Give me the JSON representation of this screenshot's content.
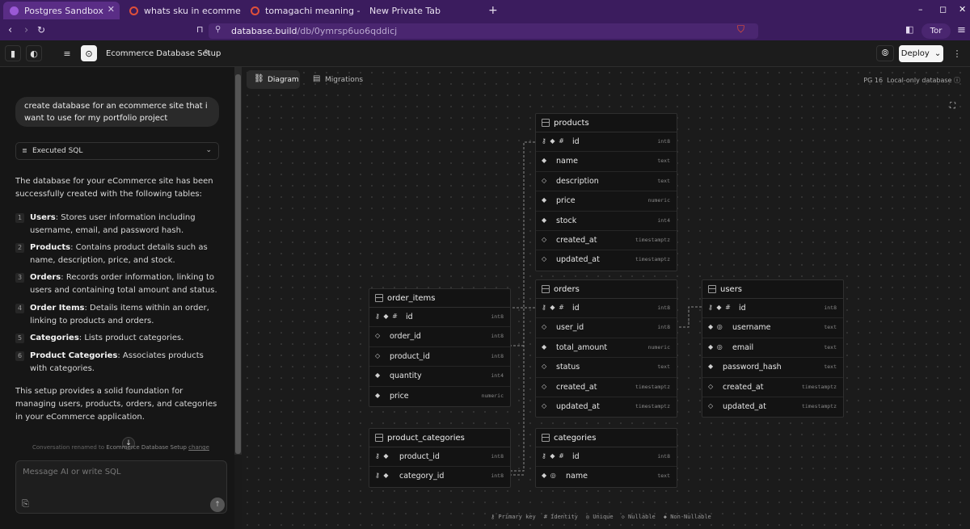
{
  "browser": {
    "tabs": [
      {
        "label": "Postgres Sandbox"
      },
      {
        "label": "whats sku in ecommerce"
      },
      {
        "label": "tomagachi meaning - Brave"
      },
      {
        "label": "New Private Tab"
      }
    ],
    "url_host": "database.build",
    "url_path": "/db/0ymrsp6uo6qddicj",
    "tor_label": "Tor"
  },
  "app": {
    "title": "Ecommerce Database Setup",
    "deploy_label": "Deploy"
  },
  "chat": {
    "user_message": "create database for an ecommerce site that i want to use for my portfolio project",
    "sql_label": "Executed SQL",
    "intro": "The database for your eCommerce site has been successfully created with the following tables:",
    "items": [
      {
        "num": "1",
        "bold": "Users",
        "text": ": Stores user information including username, email, and password hash."
      },
      {
        "num": "2",
        "bold": "Products",
        "text": ": Contains product details such as name, description, price, and stock."
      },
      {
        "num": "3",
        "bold": "Orders",
        "text": ": Records order information, linking to users and containing total amount and status."
      },
      {
        "num": "4",
        "bold": "Order Items",
        "text": ": Details items within an order, linking to products and orders."
      },
      {
        "num": "5",
        "bold": "Categories",
        "text": ": Lists product categories."
      },
      {
        "num": "6",
        "bold": "Product Categories",
        "text": ": Associates products with categories."
      }
    ],
    "outro": "This setup provides a solid foundation for managing users, products, orders, and categories in your eCommerce application.",
    "renamed_prefix": "Conversation renamed to",
    "renamed_name": "Ecommerce Database Setup",
    "renamed_link": "change",
    "input_placeholder": "Message AI or write SQL"
  },
  "canvas": {
    "diagram_tab": "Diagram",
    "migrations_tab": "Migrations",
    "pg_version": "PG 16",
    "local_only": "Local-only database",
    "legend": [
      "Primary key",
      "Identity",
      "Unique",
      "Nullable",
      "Non-Nullable"
    ]
  },
  "tables": {
    "products": {
      "name": "products",
      "columns": [
        {
          "name": "id",
          "type": "int8",
          "icons": "⚷ ◆ #"
        },
        {
          "name": "name",
          "type": "text",
          "icons": "◆"
        },
        {
          "name": "description",
          "type": "text",
          "icons": "◇"
        },
        {
          "name": "price",
          "type": "numeric",
          "icons": "◆"
        },
        {
          "name": "stock",
          "type": "int4",
          "icons": "◆"
        },
        {
          "name": "created_at",
          "type": "timestamptz",
          "icons": "◇"
        },
        {
          "name": "updated_at",
          "type": "timestamptz",
          "icons": "◇"
        }
      ]
    },
    "order_items": {
      "name": "order_items",
      "columns": [
        {
          "name": "id",
          "type": "int8",
          "icons": "⚷ ◆ #"
        },
        {
          "name": "order_id",
          "type": "int8",
          "icons": "◇"
        },
        {
          "name": "product_id",
          "type": "int8",
          "icons": "◇"
        },
        {
          "name": "quantity",
          "type": "int4",
          "icons": "◆"
        },
        {
          "name": "price",
          "type": "numeric",
          "icons": "◆"
        }
      ]
    },
    "orders": {
      "name": "orders",
      "columns": [
        {
          "name": "id",
          "type": "int8",
          "icons": "⚷ ◆ #"
        },
        {
          "name": "user_id",
          "type": "int8",
          "icons": "◇"
        },
        {
          "name": "total_amount",
          "type": "numeric",
          "icons": "◆"
        },
        {
          "name": "status",
          "type": "text",
          "icons": "◇"
        },
        {
          "name": "created_at",
          "type": "timestamptz",
          "icons": "◇"
        },
        {
          "name": "updated_at",
          "type": "timestamptz",
          "icons": "◇"
        }
      ]
    },
    "users": {
      "name": "users",
      "columns": [
        {
          "name": "id",
          "type": "int8",
          "icons": "⚷ ◆ #"
        },
        {
          "name": "username",
          "type": "text",
          "icons": "◆ ◎"
        },
        {
          "name": "email",
          "type": "text",
          "icons": "◆ ◎"
        },
        {
          "name": "password_hash",
          "type": "text",
          "icons": "◆"
        },
        {
          "name": "created_at",
          "type": "timestamptz",
          "icons": "◇"
        },
        {
          "name": "updated_at",
          "type": "timestamptz",
          "icons": "◇"
        }
      ]
    },
    "product_categories": {
      "name": "product_categories",
      "columns": [
        {
          "name": "product_id",
          "type": "int8",
          "icons": "⚷ ◆"
        },
        {
          "name": "category_id",
          "type": "int8",
          "icons": "⚷ ◆"
        }
      ]
    },
    "categories": {
      "name": "categories",
      "columns": [
        {
          "name": "id",
          "type": "int8",
          "icons": "⚷ ◆ #"
        },
        {
          "name": "name",
          "type": "text",
          "icons": "◆ ◎"
        }
      ]
    }
  }
}
